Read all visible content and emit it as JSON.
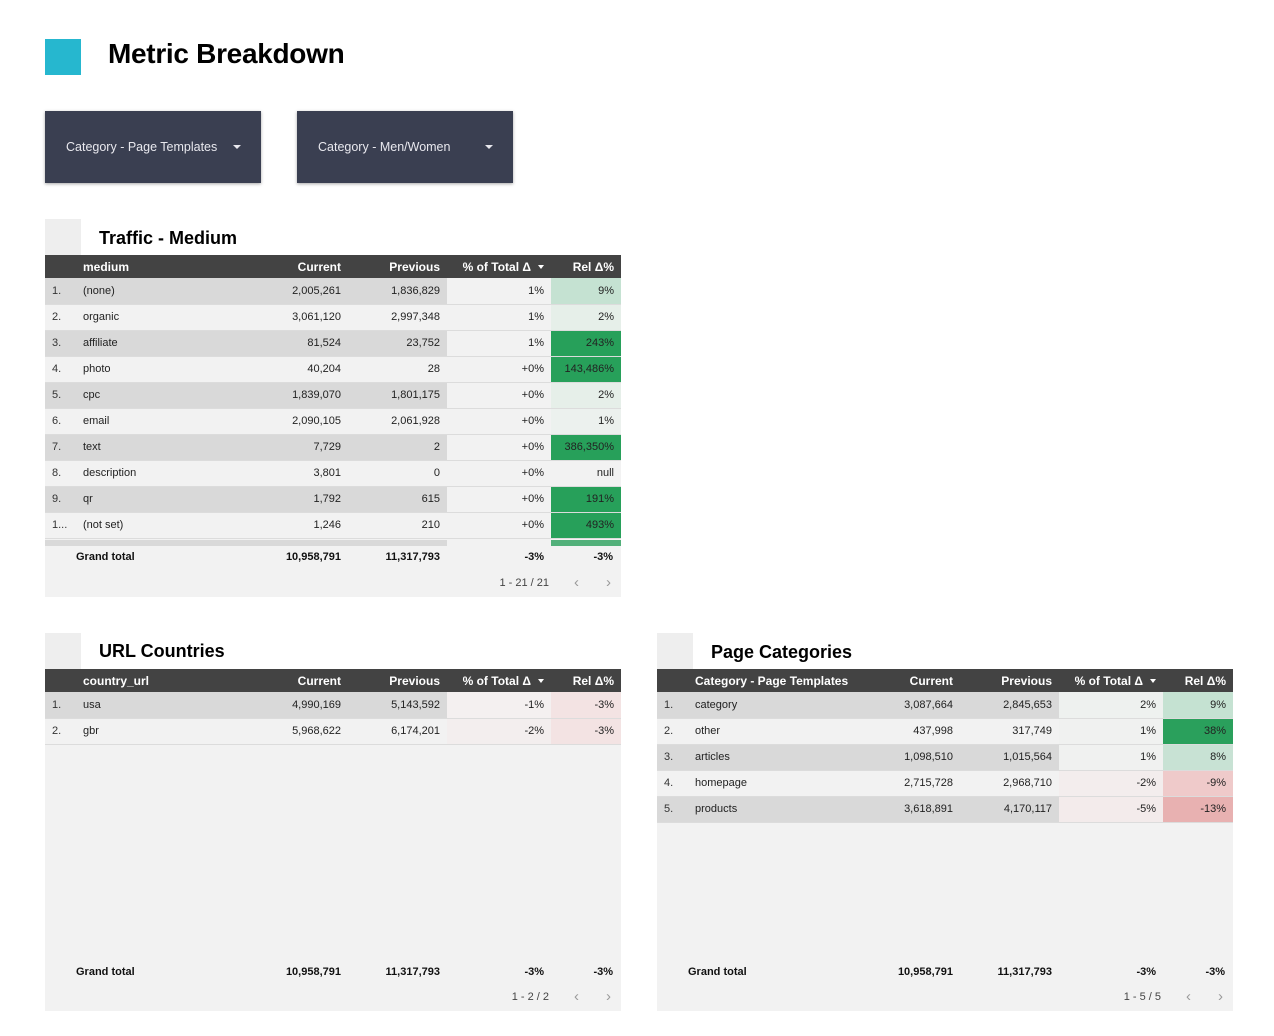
{
  "header": {
    "title": "Metric Breakdown",
    "logo_color": "#26b7cf"
  },
  "filters": [
    {
      "label": "Category - Page Templates",
      "icon": "caret-down-icon"
    },
    {
      "label": "Category - Men/Women",
      "icon": "caret-down-icon"
    }
  ],
  "colors": {
    "header_bg": "#434343",
    "filter_bg": "#3a3f51",
    "strong_positive": "#27a05a",
    "light_positive": "#c5e2d2",
    "faint_positive": "#e6efe9",
    "faint_negative": "#f3e3e3",
    "light_negative": "#efcaca",
    "mid_negative": "#e8b1b1"
  },
  "tables": {
    "traffic": {
      "title": "Traffic - Medium",
      "columns": [
        "medium",
        "Current",
        "Previous",
        "% of Total Δ",
        "Rel Δ%"
      ],
      "sorted_column": "% of Total Δ",
      "rows": [
        {
          "idx": "1.",
          "dim": "(none)",
          "current": "2,005,261",
          "previous": "1,836,829",
          "pct_total": "1%",
          "rel": "9%",
          "rel_color": "#c5e2d2",
          "pt_color": "#f2f2f2"
        },
        {
          "idx": "2.",
          "dim": "organic",
          "current": "3,061,120",
          "previous": "2,997,348",
          "pct_total": "1%",
          "rel": "2%",
          "rel_color": "#e6efe9",
          "pt_color": "#f2f2f2"
        },
        {
          "idx": "3.",
          "dim": "affiliate",
          "current": "81,524",
          "previous": "23,752",
          "pct_total": "1%",
          "rel": "243%",
          "rel_color": "#27a05a",
          "pt_color": "#f2f2f2"
        },
        {
          "idx": "4.",
          "dim": "photo",
          "current": "40,204",
          "previous": "28",
          "pct_total": "+0%",
          "rel": "143,486%",
          "rel_color": "#27a05a",
          "pt_color": "#f2f2f2"
        },
        {
          "idx": "5.",
          "dim": "cpc",
          "current": "1,839,070",
          "previous": "1,801,175",
          "pct_total": "+0%",
          "rel": "2%",
          "rel_color": "#e6efe9",
          "pt_color": "#f2f2f2"
        },
        {
          "idx": "6.",
          "dim": "email",
          "current": "2,090,105",
          "previous": "2,061,928",
          "pct_total": "+0%",
          "rel": "1%",
          "rel_color": "#ecf1ee",
          "pt_color": "#f2f2f2"
        },
        {
          "idx": "7.",
          "dim": "text",
          "current": "7,729",
          "previous": "2",
          "pct_total": "+0%",
          "rel": "386,350%",
          "rel_color": "#27a05a",
          "pt_color": "#f2f2f2"
        },
        {
          "idx": "8.",
          "dim": "description",
          "current": "3,801",
          "previous": "0",
          "pct_total": "+0%",
          "rel": "null",
          "rel_color": "#f2f2f2",
          "pt_color": "#f2f2f2"
        },
        {
          "idx": "9.",
          "dim": "qr",
          "current": "1,792",
          "previous": "615",
          "pct_total": "+0%",
          "rel": "191%",
          "rel_color": "#27a05a",
          "pt_color": "#f2f2f2"
        },
        {
          "idx": "1...",
          "dim": "(not set)",
          "current": "1,246",
          "previous": "210",
          "pct_total": "+0%",
          "rel": "493%",
          "rel_color": "#27a05a",
          "pt_color": "#f2f2f2"
        }
      ],
      "grand_total": {
        "label": "Grand total",
        "current": "10,958,791",
        "previous": "11,317,793",
        "pct_total": "-3%",
        "rel": "-3%"
      },
      "pagination": "1 - 21 / 21"
    },
    "countries": {
      "title": "URL Countries",
      "columns": [
        "country_url",
        "Current",
        "Previous",
        "% of Total Δ",
        "Rel Δ%"
      ],
      "sorted_column": "% of Total Δ",
      "rows": [
        {
          "idx": "1.",
          "dim": "usa",
          "current": "4,990,169",
          "previous": "5,143,592",
          "pct_total": "-1%",
          "rel": "-3%",
          "rel_color": "#f3e3e3",
          "pt_color": "#f4f0f0"
        },
        {
          "idx": "2.",
          "dim": "gbr",
          "current": "5,968,622",
          "previous": "6,174,201",
          "pct_total": "-2%",
          "rel": "-3%",
          "rel_color": "#f3e3e3",
          "pt_color": "#f3eeee"
        }
      ],
      "grand_total": {
        "label": "Grand total",
        "current": "10,958,791",
        "previous": "11,317,793",
        "pct_total": "-3%",
        "rel": "-3%"
      },
      "pagination": "1 - 2 / 2"
    },
    "categories": {
      "title": "Page Categories",
      "columns": [
        "Category - Page Templates",
        "Current",
        "Previous",
        "% of Total Δ",
        "Rel Δ%"
      ],
      "sorted_column": "% of Total Δ",
      "rows": [
        {
          "idx": "1.",
          "dim": "category",
          "current": "3,087,664",
          "previous": "2,845,653",
          "pct_total": "2%",
          "rel": "9%",
          "rel_color": "#c5e2d2",
          "pt_color": "#eef1ef"
        },
        {
          "idx": "2.",
          "dim": "other",
          "current": "437,998",
          "previous": "317,749",
          "pct_total": "1%",
          "rel": "38%",
          "rel_color": "#2aa05c",
          "pt_color": "#f0f1f0"
        },
        {
          "idx": "3.",
          "dim": "articles",
          "current": "1,098,510",
          "previous": "1,015,564",
          "pct_total": "1%",
          "rel": "8%",
          "rel_color": "#c8e2d4",
          "pt_color": "#f0f1f0"
        },
        {
          "idx": "4.",
          "dim": "homepage",
          "current": "2,715,728",
          "previous": "2,968,710",
          "pct_total": "-2%",
          "rel": "-9%",
          "rel_color": "#efcaca",
          "pt_color": "#f3eded"
        },
        {
          "idx": "5.",
          "dim": "products",
          "current": "3,618,891",
          "previous": "4,170,117",
          "pct_total": "-5%",
          "rel": "-13%",
          "rel_color": "#e8b1b1",
          "pt_color": "#f3ebeb"
        }
      ],
      "grand_total": {
        "label": "Grand total",
        "current": "10,958,791",
        "previous": "11,317,793",
        "pct_total": "-3%",
        "rel": "-3%"
      },
      "pagination": "1 - 5 / 5"
    }
  }
}
